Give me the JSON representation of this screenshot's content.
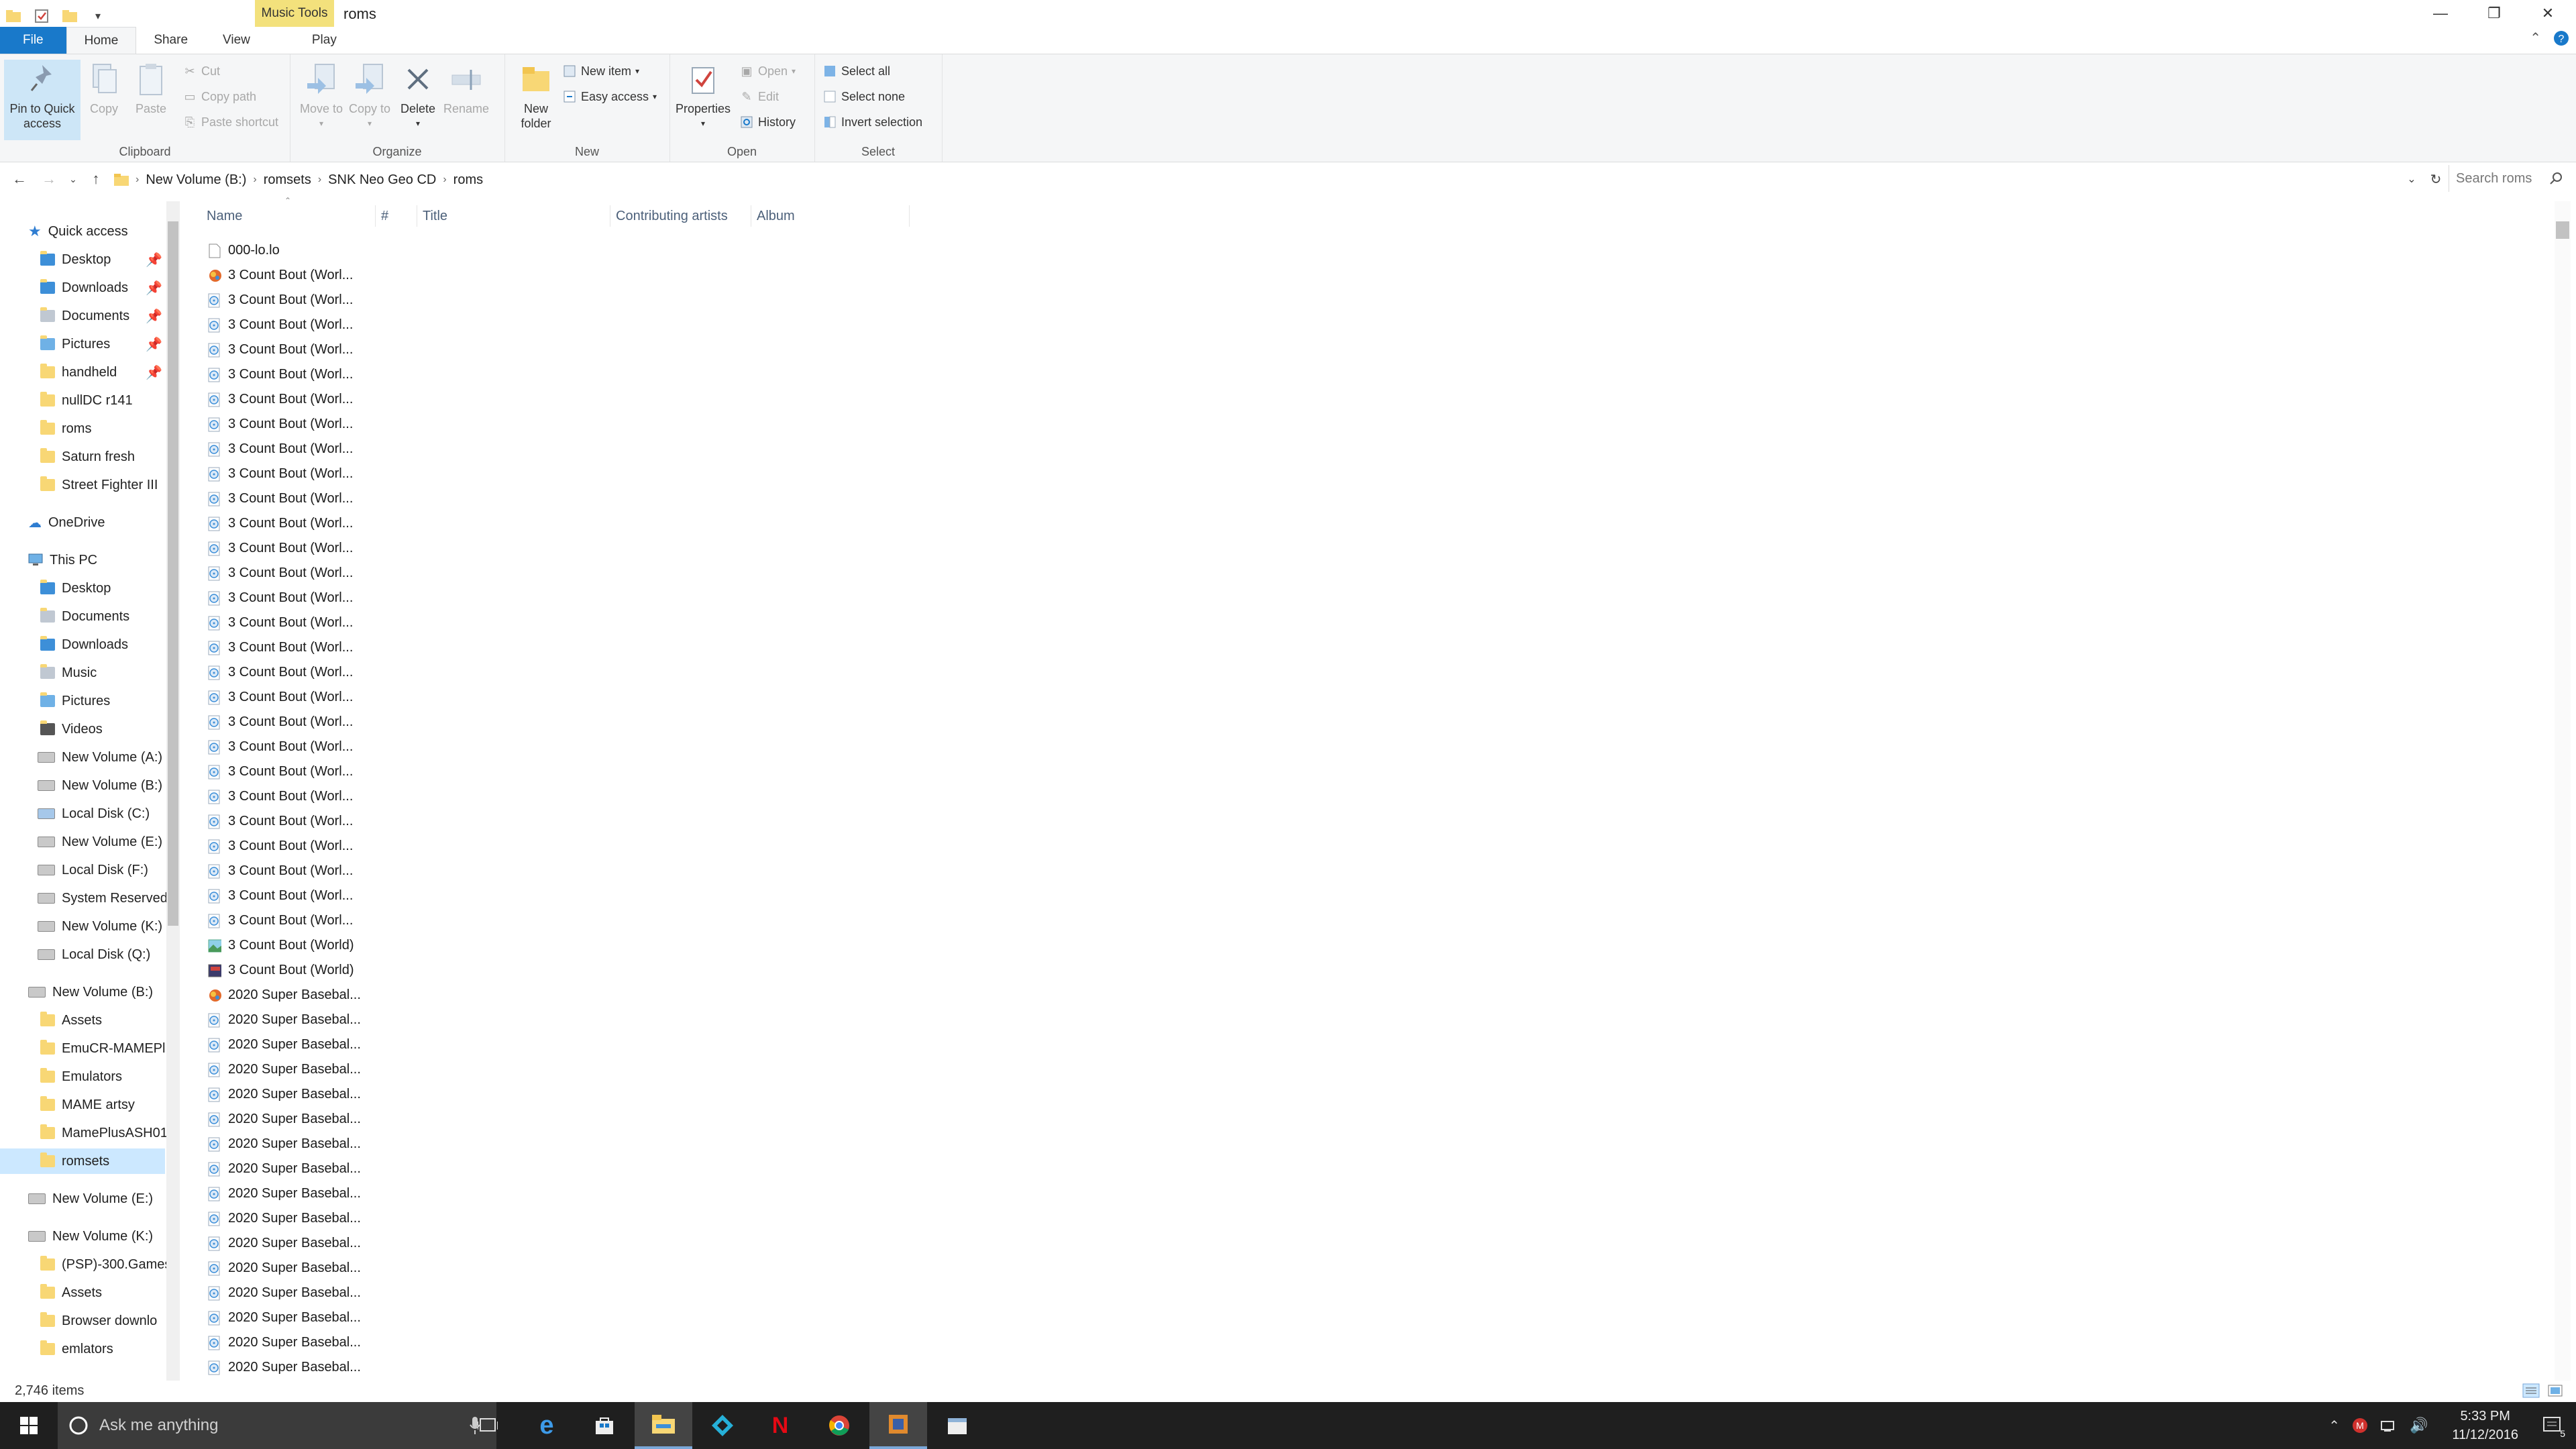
{
  "window": {
    "context_tab": "Music Tools",
    "title": "roms",
    "minimize": "—",
    "restore": "❐",
    "close": "✕"
  },
  "tabs": [
    {
      "label": "File"
    },
    {
      "label": "Home"
    },
    {
      "label": "Share"
    },
    {
      "label": "View"
    },
    {
      "label": "Play"
    }
  ],
  "ribbon": {
    "clipboard": {
      "label": "Clipboard",
      "pin": "Pin to Quick access",
      "copy": "Copy",
      "paste": "Paste",
      "cut": "Cut",
      "copy_path": "Copy path",
      "paste_shortcut": "Paste shortcut"
    },
    "organize": {
      "label": "Organize",
      "move_to": "Move to",
      "copy_to": "Copy to",
      "delete": "Delete",
      "rename": "Rename"
    },
    "new": {
      "label": "New",
      "new_folder": "New folder",
      "new_item": "New item",
      "easy_access": "Easy access"
    },
    "open": {
      "label": "Open",
      "properties": "Properties",
      "open": "Open",
      "edit": "Edit",
      "history": "History"
    },
    "select": {
      "label": "Select",
      "select_all": "Select all",
      "select_none": "Select none",
      "invert": "Invert selection"
    }
  },
  "address": {
    "crumbs": [
      "New Volume (B:)",
      "romsets",
      "SNK Neo Geo CD",
      "roms"
    ],
    "search_placeholder": "Search roms"
  },
  "nav": {
    "quick_access": "Quick access",
    "quick_items": [
      "Desktop",
      "Downloads",
      "Documents",
      "Pictures",
      "handheld",
      "nullDC r141",
      "roms",
      "Saturn fresh",
      "Street Fighter III"
    ],
    "onedrive": "OneDrive",
    "this_pc": "This PC",
    "pc_items": [
      "Desktop",
      "Documents",
      "Downloads",
      "Music",
      "Pictures",
      "Videos",
      "New Volume (A:)",
      "New Volume (B:)",
      "Local Disk (C:)",
      "New Volume (E:)",
      "Local Disk (F:)",
      "System Reserved",
      "New Volume (K:)",
      "Local Disk (Q:)"
    ],
    "vol_b": "New Volume (B:)",
    "vol_b_items": [
      "Assets",
      "EmuCR-MAMEPl",
      "Emulators",
      "MAME artsy",
      "MamePlusASH01",
      "romsets"
    ],
    "vol_e": "New Volume (E:)",
    "vol_k": "New Volume (K:)",
    "vol_k_items": [
      "(PSP)-300.Games",
      "Assets",
      "Browser downlo",
      "emlators"
    ]
  },
  "columns": {
    "name": "Name",
    "number": "#",
    "title": "Title",
    "artists": "Contributing artists",
    "album": "Album"
  },
  "files": {
    "first": "000-lo.lo",
    "bout_trunc": "3 Count Bout (Worl...",
    "bout_full": "3 Count Bout (World)",
    "baseball_trunc": "2020 Super Basebal..."
  },
  "status": {
    "count": "2,746 items"
  },
  "taskbar": {
    "search_placeholder": "Ask me anything",
    "time": "5:33 PM",
    "date": "11/12/2016",
    "notifications": "5"
  },
  "colors": {
    "accent": "#1979ca",
    "folder": "#f8d775",
    "context_tab": "#f3e17c",
    "selection": "#cce8ff"
  }
}
